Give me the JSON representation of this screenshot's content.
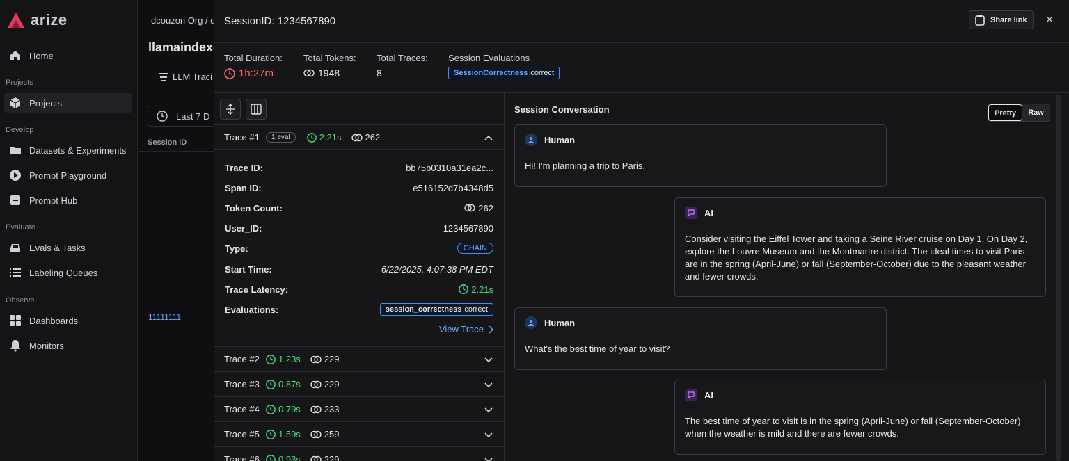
{
  "brand": {
    "name": "arize"
  },
  "sidebar": {
    "home": "Home",
    "sections": {
      "projects": "Projects",
      "develop": "Develop",
      "evaluate": "Evaluate",
      "observe": "Observe"
    },
    "items": {
      "projects": "Projects",
      "datasets": "Datasets & Experiments",
      "playground": "Prompt Playground",
      "hub": "Prompt Hub",
      "evals": "Evals & Tasks",
      "labeling": "Labeling Queues",
      "dashboards": "Dashboards",
      "monitors": "Monitors"
    }
  },
  "background": {
    "breadcrumb": "dcouzon Org / d",
    "title": "llamaindex-",
    "tab": "LLM Traci",
    "filter": "Last 7 D",
    "column": "Session ID",
    "cell": "11111111"
  },
  "drawer": {
    "title": "SessionID: 1234567890",
    "share": "Share link",
    "close": "×",
    "stats": {
      "duration_label": "Total Duration:",
      "duration": "1h:27m",
      "tokens_label": "Total Tokens:",
      "tokens": "1948",
      "traces_label": "Total Traces:",
      "traces": "8",
      "evals_label": "Session Evaluations",
      "eval_key": "SessionCorrectness",
      "eval_val": "correct"
    }
  },
  "traces": [
    {
      "name": "Trace #1",
      "evals": "1 eval",
      "latency": "2.21s",
      "tokens": "262"
    },
    {
      "name": "Trace #2",
      "latency": "1.23s",
      "tokens": "229"
    },
    {
      "name": "Trace #3",
      "latency": "0.87s",
      "tokens": "229"
    },
    {
      "name": "Trace #4",
      "latency": "0.79s",
      "tokens": "233"
    },
    {
      "name": "Trace #5",
      "latency": "1.59s",
      "tokens": "259"
    },
    {
      "name": "Trace #6",
      "latency": "0.93s",
      "tokens": "229"
    }
  ],
  "detail": {
    "trace_id_label": "Trace ID:",
    "trace_id": "bb75b0310a31ea2c...",
    "span_id_label": "Span ID:",
    "span_id": "e516152d7b4348d5",
    "token_label": "Token Count:",
    "token": "262",
    "user_label": "User_ID:",
    "user": "1234567890",
    "type_label": "Type:",
    "type": "CHAIN",
    "start_label": "Start Time:",
    "start": "6/22/2025, 4:07:38 PM EDT",
    "latency_label": "Trace Latency:",
    "latency": "2.21s",
    "evals_label": "Evaluations:",
    "eval_key": "session_correctness",
    "eval_val": "correct",
    "view": "View Trace"
  },
  "conversation": {
    "title": "Session Conversation",
    "pretty": "Pretty",
    "raw": "Raw",
    "messages": [
      {
        "role": "Human",
        "text": "Hi! I'm planning a trip to Paris."
      },
      {
        "role": "AI",
        "text": "Consider visiting the Eiffel Tower and taking a Seine River cruise on Day 1. On Day 2, explore the Louvre Museum and the Montmartre district. The ideal times to visit Paris are in the spring (April-June) or fall (September-October) due to the pleasant weather and fewer crowds."
      },
      {
        "role": "Human",
        "text": "What's the best time of year to visit?"
      },
      {
        "role": "AI",
        "text": "The best time of year to visit is in the spring (April-June) or fall (September-October) when the weather is mild and there are fewer crowds."
      }
    ]
  },
  "colors": {
    "accent": "#4c8cf5",
    "success": "#4ade80",
    "danger": "#ff6b6b",
    "brand": "#e0395a"
  }
}
